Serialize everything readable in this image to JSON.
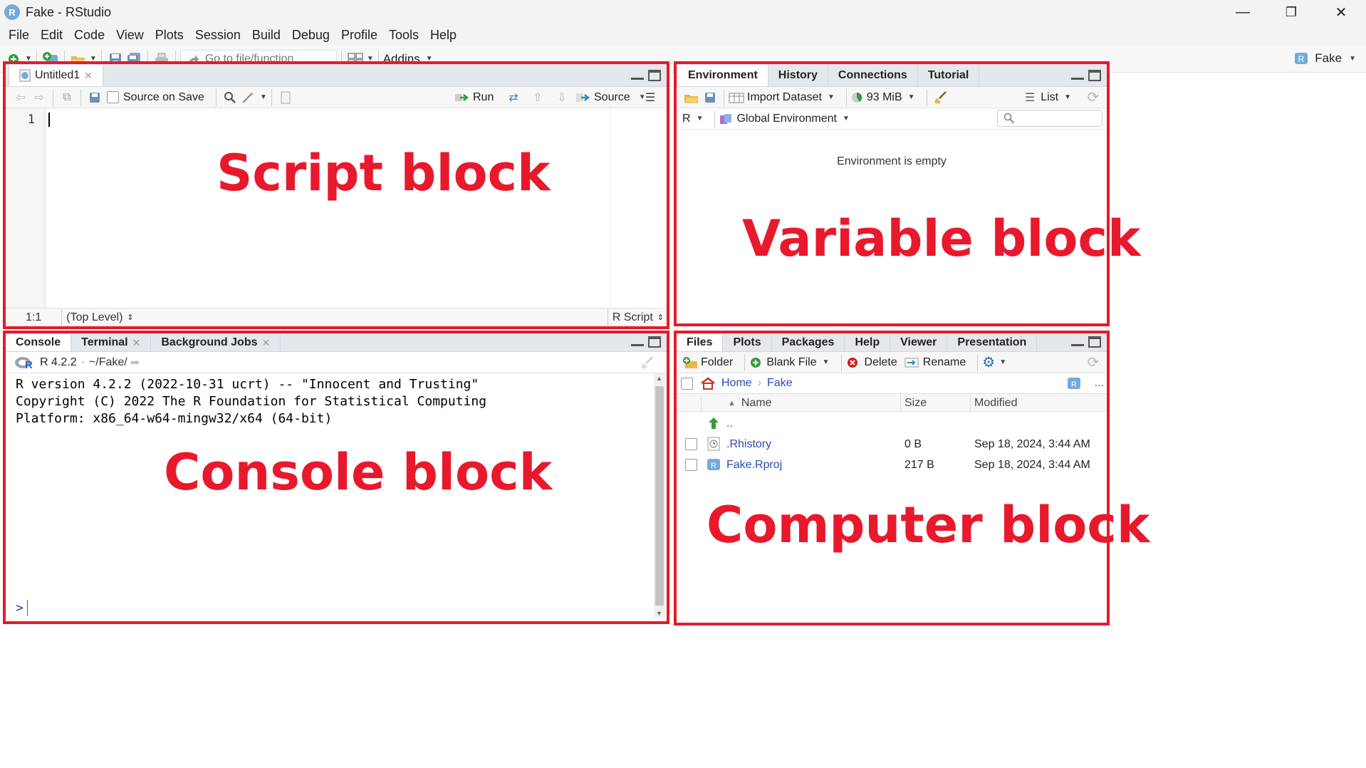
{
  "window": {
    "title": "Fake - RStudio",
    "logo": "R",
    "minimize": "—",
    "restore": "❐",
    "close": "✕"
  },
  "menu": [
    "File",
    "Edit",
    "Code",
    "View",
    "Plots",
    "Session",
    "Build",
    "Debug",
    "Profile",
    "Tools",
    "Help"
  ],
  "toolbar": {
    "goto_placeholder": "Go to file/function",
    "addins_label": "Addins",
    "project_label": "Fake"
  },
  "script": {
    "tab_label": "Untitled1",
    "source_on_save": "Source on Save",
    "run_label": "Run",
    "source_label": "Source",
    "line_number": "1",
    "position": "1:1",
    "scope": "(Top Level)",
    "filetype": "R Script",
    "annotation": "Script block"
  },
  "environment": {
    "tabs": [
      "Environment",
      "History",
      "Connections",
      "Tutorial"
    ],
    "import_label": "Import Dataset",
    "memory_label": "93 MiB",
    "list_label": "List",
    "language": "R",
    "scope_label": "Global Environment",
    "empty_message": "Environment is empty",
    "annotation": "Variable block"
  },
  "console": {
    "tabs": [
      "Console",
      "Terminal",
      "Background Jobs"
    ],
    "r_version_label": "R 4.2.2",
    "path": "~/Fake/",
    "lines": [
      "R version 4.2.2 (2022-10-31 ucrt) -- \"Innocent and Trusting\"",
      "Copyright (C) 2022 The R Foundation for Statistical Computing",
      "Platform: x86_64-w64-mingw32/x64 (64-bit)"
    ],
    "prompt": ">",
    "annotation": "Console block"
  },
  "files": {
    "tabs": [
      "Files",
      "Plots",
      "Packages",
      "Help",
      "Viewer",
      "Presentation"
    ],
    "folder_label": "Folder",
    "blank_file_label": "Blank File",
    "delete_label": "Delete",
    "rename_label": "Rename",
    "breadcrumb": [
      "Home",
      "Fake"
    ],
    "columns": [
      "Name",
      "Size",
      "Modified"
    ],
    "up_label": "..",
    "rows": [
      {
        "name": ".Rhistory",
        "size": "0 B",
        "modified": "Sep 18, 2024, 3:44 AM"
      },
      {
        "name": "Fake.Rproj",
        "size": "217 B",
        "modified": "Sep 18, 2024, 3:44 AM"
      }
    ],
    "more": "...",
    "annotation": "Computer block"
  },
  "colors": {
    "annotation_red": "#e8192c",
    "link_blue": "#2a4db3",
    "tab_bg": "#e4e8ec"
  }
}
